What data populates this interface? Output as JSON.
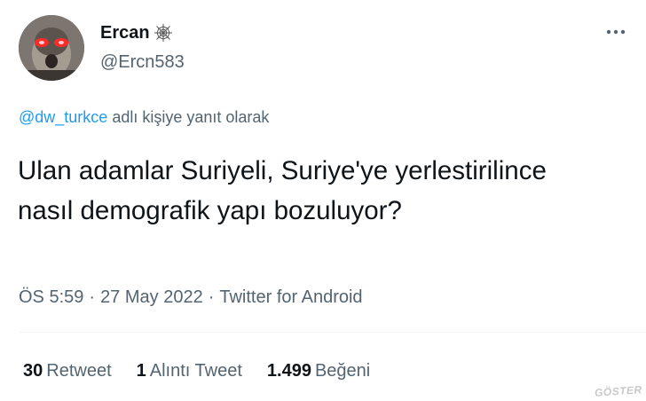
{
  "author": {
    "name": "Ercan",
    "handle": "@Ercn583",
    "name_badge_icon": "spider-web-icon",
    "avatar_icon": "avatar-image"
  },
  "reply_context": {
    "handle_link": "@dw_turkce",
    "text": " adlı kişiye yanıt olarak"
  },
  "tweet": {
    "text": "Ulan adamlar Suriyeli, Suriye'ye yerlestirilince nasıl demografik yapı bozuluyor?",
    "time": "ÖS 5:59",
    "separator": "·",
    "date": "27 May 2022",
    "source": "Twitter for Android"
  },
  "stats": [
    {
      "count": "30",
      "label": "Retweet"
    },
    {
      "count": "1",
      "label": "Alıntı Tweet"
    },
    {
      "count": "1.499",
      "label": "Beğeni"
    }
  ],
  "watermark": "GÖSTER",
  "colors": {
    "link": "#1d9bf0",
    "secondary_text": "#536471",
    "primary_text": "#0f1419",
    "divider": "#eff3f4"
  }
}
